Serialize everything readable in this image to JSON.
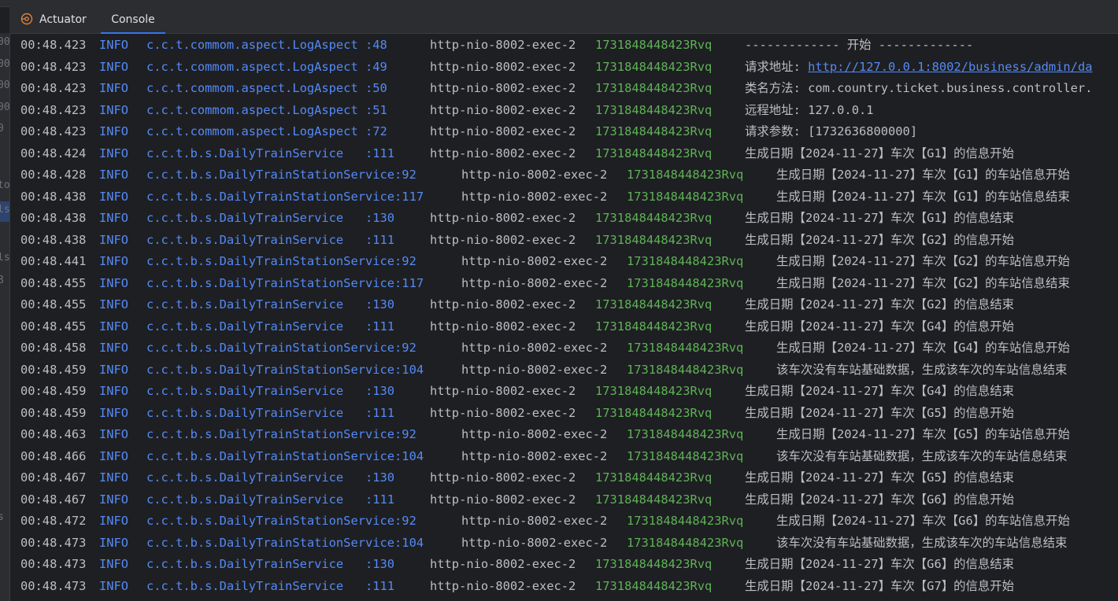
{
  "tabs": [
    {
      "label": "Actuator",
      "icon": "actuator-icon"
    },
    {
      "label": "Console"
    }
  ],
  "active_tab": "Console",
  "gutter_fragments": [
    "00",
    "00",
    "00",
    "00",
    "0",
    "to",
    "ls",
    "ls",
    "8",
    "s"
  ],
  "log_rows": [
    {
      "time": "00:48.423",
      "level": "INFO",
      "logger": "c.c.t.commom.aspect.LogAspect :48 ",
      "thread": "http-nio-8002-exec-2",
      "trace": "1731848448423Rvq",
      "label": "",
      "msg": "------------- 开始 -------------",
      "link": ""
    },
    {
      "time": "00:48.423",
      "level": "INFO",
      "logger": "c.c.t.commom.aspect.LogAspect :49 ",
      "thread": "http-nio-8002-exec-2",
      "trace": "1731848448423Rvq",
      "label": "请求地址: ",
      "msg": "",
      "link": "http://127.0.0.1:8002/business/admin/da"
    },
    {
      "time": "00:48.423",
      "level": "INFO",
      "logger": "c.c.t.commom.aspect.LogAspect :50 ",
      "thread": "http-nio-8002-exec-2",
      "trace": "1731848448423Rvq",
      "label": "",
      "msg": "类名方法: com.country.ticket.business.controller.",
      "link": ""
    },
    {
      "time": "00:48.423",
      "level": "INFO",
      "logger": "c.c.t.commom.aspect.LogAspect :51 ",
      "thread": "http-nio-8002-exec-2",
      "trace": "1731848448423Rvq",
      "label": "",
      "msg": "远程地址: 127.0.0.1",
      "link": ""
    },
    {
      "time": "00:48.423",
      "level": "INFO",
      "logger": "c.c.t.commom.aspect.LogAspect :72 ",
      "thread": "http-nio-8002-exec-2",
      "trace": "1731848448423Rvq",
      "label": "",
      "msg": "请求参数: [1732636800000]",
      "link": ""
    },
    {
      "time": "00:48.424",
      "level": "INFO",
      "logger": "c.c.t.b.s.DailyTrainService   :111",
      "thread": "http-nio-8002-exec-2",
      "trace": "1731848448423Rvq",
      "label": "",
      "msg": "生成日期【2024-11-27】车次【G1】的信息开始",
      "link": ""
    },
    {
      "time": "00:48.428",
      "level": "INFO",
      "logger": "c.c.t.b.s.DailyTrainStationService:92 ",
      "thread": "http-nio-8002-exec-2",
      "trace": "1731848448423Rvq",
      "label": "",
      "msg": "生成日期【2024-11-27】车次【G1】的车站信息开始",
      "link": ""
    },
    {
      "time": "00:48.438",
      "level": "INFO",
      "logger": "c.c.t.b.s.DailyTrainStationService:117",
      "thread": "http-nio-8002-exec-2",
      "trace": "1731848448423Rvq",
      "label": "",
      "msg": "生成日期【2024-11-27】车次【G1】的车站信息结束",
      "link": ""
    },
    {
      "time": "00:48.438",
      "level": "INFO",
      "logger": "c.c.t.b.s.DailyTrainService   :130",
      "thread": "http-nio-8002-exec-2",
      "trace": "1731848448423Rvq",
      "label": "",
      "msg": "生成日期【2024-11-27】车次【G1】的信息结束",
      "link": ""
    },
    {
      "time": "00:48.438",
      "level": "INFO",
      "logger": "c.c.t.b.s.DailyTrainService   :111",
      "thread": "http-nio-8002-exec-2",
      "trace": "1731848448423Rvq",
      "label": "",
      "msg": "生成日期【2024-11-27】车次【G2】的信息开始",
      "link": ""
    },
    {
      "time": "00:48.441",
      "level": "INFO",
      "logger": "c.c.t.b.s.DailyTrainStationService:92 ",
      "thread": "http-nio-8002-exec-2",
      "trace": "1731848448423Rvq",
      "label": "",
      "msg": "生成日期【2024-11-27】车次【G2】的车站信息开始",
      "link": ""
    },
    {
      "time": "00:48.455",
      "level": "INFO",
      "logger": "c.c.t.b.s.DailyTrainStationService:117",
      "thread": "http-nio-8002-exec-2",
      "trace": "1731848448423Rvq",
      "label": "",
      "msg": "生成日期【2024-11-27】车次【G2】的车站信息结束",
      "link": ""
    },
    {
      "time": "00:48.455",
      "level": "INFO",
      "logger": "c.c.t.b.s.DailyTrainService   :130",
      "thread": "http-nio-8002-exec-2",
      "trace": "1731848448423Rvq",
      "label": "",
      "msg": "生成日期【2024-11-27】车次【G2】的信息结束",
      "link": ""
    },
    {
      "time": "00:48.455",
      "level": "INFO",
      "logger": "c.c.t.b.s.DailyTrainService   :111",
      "thread": "http-nio-8002-exec-2",
      "trace": "1731848448423Rvq",
      "label": "",
      "msg": "生成日期【2024-11-27】车次【G4】的信息开始",
      "link": ""
    },
    {
      "time": "00:48.458",
      "level": "INFO",
      "logger": "c.c.t.b.s.DailyTrainStationService:92 ",
      "thread": "http-nio-8002-exec-2",
      "trace": "1731848448423Rvq",
      "label": "",
      "msg": "生成日期【2024-11-27】车次【G4】的车站信息开始",
      "link": ""
    },
    {
      "time": "00:48.459",
      "level": "INFO",
      "logger": "c.c.t.b.s.DailyTrainStationService:104",
      "thread": "http-nio-8002-exec-2",
      "trace": "1731848448423Rvq",
      "label": "",
      "msg": "该车次没有车站基础数据，生成该车次的车站信息结束",
      "link": ""
    },
    {
      "time": "00:48.459",
      "level": "INFO",
      "logger": "c.c.t.b.s.DailyTrainService   :130",
      "thread": "http-nio-8002-exec-2",
      "trace": "1731848448423Rvq",
      "label": "",
      "msg": "生成日期【2024-11-27】车次【G4】的信息结束",
      "link": ""
    },
    {
      "time": "00:48.459",
      "level": "INFO",
      "logger": "c.c.t.b.s.DailyTrainService   :111",
      "thread": "http-nio-8002-exec-2",
      "trace": "1731848448423Rvq",
      "label": "",
      "msg": "生成日期【2024-11-27】车次【G5】的信息开始",
      "link": ""
    },
    {
      "time": "00:48.463",
      "level": "INFO",
      "logger": "c.c.t.b.s.DailyTrainStationService:92 ",
      "thread": "http-nio-8002-exec-2",
      "trace": "1731848448423Rvq",
      "label": "",
      "msg": "生成日期【2024-11-27】车次【G5】的车站信息开始",
      "link": ""
    },
    {
      "time": "00:48.466",
      "level": "INFO",
      "logger": "c.c.t.b.s.DailyTrainStationService:104",
      "thread": "http-nio-8002-exec-2",
      "trace": "1731848448423Rvq",
      "label": "",
      "msg": "该车次没有车站基础数据，生成该车次的车站信息结束",
      "link": ""
    },
    {
      "time": "00:48.467",
      "level": "INFO",
      "logger": "c.c.t.b.s.DailyTrainService   :130",
      "thread": "http-nio-8002-exec-2",
      "trace": "1731848448423Rvq",
      "label": "",
      "msg": "生成日期【2024-11-27】车次【G5】的信息结束",
      "link": ""
    },
    {
      "time": "00:48.467",
      "level": "INFO",
      "logger": "c.c.t.b.s.DailyTrainService   :111",
      "thread": "http-nio-8002-exec-2",
      "trace": "1731848448423Rvq",
      "label": "",
      "msg": "生成日期【2024-11-27】车次【G6】的信息开始",
      "link": ""
    },
    {
      "time": "00:48.472",
      "level": "INFO",
      "logger": "c.c.t.b.s.DailyTrainStationService:92 ",
      "thread": "http-nio-8002-exec-2",
      "trace": "1731848448423Rvq",
      "label": "",
      "msg": "生成日期【2024-11-27】车次【G6】的车站信息开始",
      "link": ""
    },
    {
      "time": "00:48.473",
      "level": "INFO",
      "logger": "c.c.t.b.s.DailyTrainStationService:104",
      "thread": "http-nio-8002-exec-2",
      "trace": "1731848448423Rvq",
      "label": "",
      "msg": "该车次没有车站基础数据，生成该车次的车站信息结束",
      "link": ""
    },
    {
      "time": "00:48.473",
      "level": "INFO",
      "logger": "c.c.t.b.s.DailyTrainService   :130",
      "thread": "http-nio-8002-exec-2",
      "trace": "1731848448423Rvq",
      "label": "",
      "msg": "生成日期【2024-11-27】车次【G6】的信息结束",
      "link": ""
    },
    {
      "time": "00:48.473",
      "level": "INFO",
      "logger": "c.c.t.b.s.DailyTrainService   :111",
      "thread": "http-nio-8002-exec-2",
      "trace": "1731848448423Rvq",
      "label": "",
      "msg": "生成日期【2024-11-27】车次【G7】的信息开始",
      "link": ""
    }
  ],
  "colors": {
    "background": "#1e1f22",
    "panel": "#2b2d30",
    "accent": "#3574f0",
    "logger_blue": "#548af7",
    "trace_green": "#5fb158",
    "text": "#bcbec4"
  }
}
